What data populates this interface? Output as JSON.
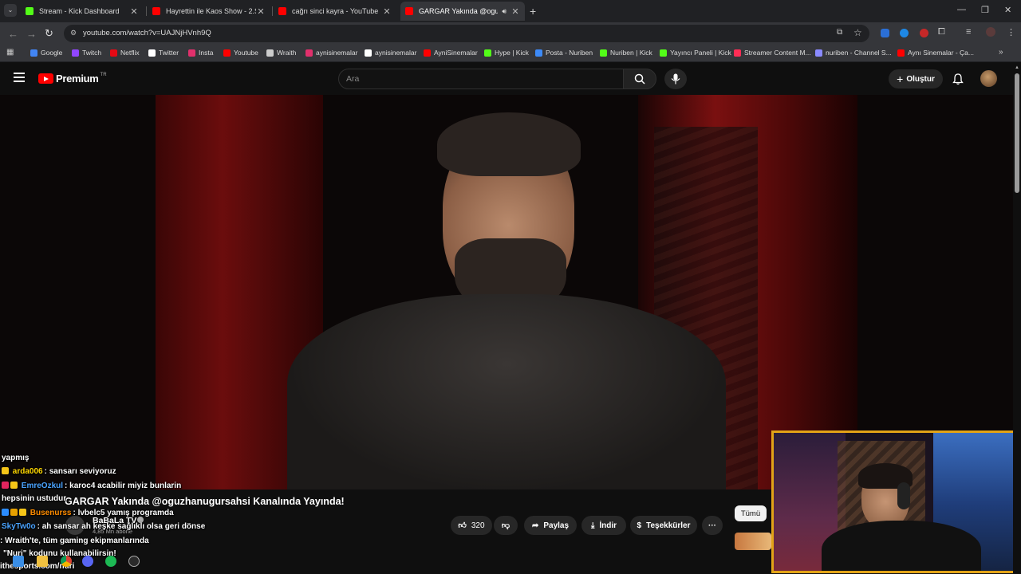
{
  "browser": {
    "tabs": [
      {
        "title": "Stream - Kick Dashboard",
        "icon": "kick-icon",
        "color": "#53fc18"
      },
      {
        "title": "Hayrettin ile Kaos Show - 2.Sez",
        "icon": "youtube-icon",
        "color": "#ff0000"
      },
      {
        "title": "cağrı sinci kayra - YouTube",
        "icon": "youtube-icon",
        "color": "#ff0000"
      },
      {
        "title": "GARGAR Yakında @oguzha",
        "icon": "youtube-icon",
        "color": "#ff0000",
        "active": true
      }
    ],
    "url": "youtube.com/watch?v=UAJNjHVnh9Q",
    "bookmarks": [
      {
        "label": "Google",
        "icon": "google-icon",
        "color": "#4285f4"
      },
      {
        "label": "Twitch",
        "icon": "twitch-icon",
        "color": "#9146ff"
      },
      {
        "label": "Netflix",
        "icon": "netflix-icon",
        "color": "#e50914"
      },
      {
        "label": "Twitter",
        "icon": "x-icon",
        "color": "#ffffff"
      },
      {
        "label": "Insta",
        "icon": "instagram-icon",
        "color": "#e1306c"
      },
      {
        "label": "Youtube",
        "icon": "youtube-icon",
        "color": "#ff0000"
      },
      {
        "label": "Wraith",
        "icon": "wraith-icon",
        "color": "#cccccc"
      },
      {
        "label": "aynisinemalar",
        "icon": "instagram-icon",
        "color": "#e1306c"
      },
      {
        "label": "aynisinemalar",
        "icon": "x-icon",
        "color": "#ffffff"
      },
      {
        "label": "AyniSinemalar",
        "icon": "youtube-icon",
        "color": "#ff0000"
      },
      {
        "label": "Hype | Kick",
        "icon": "kick-icon",
        "color": "#53fc18"
      },
      {
        "label": "Posta - Nuriben",
        "icon": "mail-icon",
        "color": "#3d8af7"
      },
      {
        "label": "Nuriben | Kick",
        "icon": "kick-icon",
        "color": "#53fc18"
      },
      {
        "label": "Yayıncı Paneli | Kick",
        "icon": "kick-icon",
        "color": "#53fc18"
      },
      {
        "label": "Streamer Content M...",
        "icon": "streamer-icon",
        "color": "#ff2d55"
      },
      {
        "label": "nuriben - Channel S...",
        "icon": "channel-icon",
        "color": "#8a8aff"
      },
      {
        "label": "Aynı Sinemalar - Ça...",
        "icon": "youtube-icon",
        "color": "#ff0000"
      }
    ]
  },
  "youtube": {
    "logo": "Premium",
    "logo_region": "TR",
    "search_placeholder": "Ara",
    "create_label": "Oluştur",
    "video_title": "GARGAR Yakında @oguzhanugursahsi Kanalında Yayında!",
    "channel_name": "BaBaLa TV",
    "subscribers": "4,85 Mn abone",
    "likes": "320",
    "share_label": "Paylaş",
    "download_label": "İndir",
    "thanks_label": "Teşekkürler",
    "filter_all": "Tümü"
  },
  "chat": [
    {
      "user": "",
      "text": "yapmış",
      "user_color": "#ffffff"
    },
    {
      "user": "arda006",
      "text": ": sansarı seviyoruz",
      "user_color": "#ffd700"
    },
    {
      "user": "EmreOzkul",
      "text": ": karoc4 acabilir miyiz bunlarin",
      "user_color": "#4aa3ff"
    },
    {
      "user": "",
      "text": "hepsinin ustudur",
      "user_color": "#ffffff"
    },
    {
      "user": "Busenurss",
      "text": ": lvbelc5 yamış programda",
      "user_color": "#ff8c00"
    },
    {
      "user": "SkyTw0o",
      "text": ": ah sansar ah keşke sağlıklı olsa geri dönse",
      "user_color": "#4aa3ff"
    },
    {
      "user": "",
      "text": ": Wraith'te, tüm gaming ekipmanlarında",
      "user_color": "#ffffff"
    },
    {
      "user": "",
      "text": "\"Nuri\" kodunu kullanabilirsin!",
      "user_color": "#ffffff"
    },
    {
      "user": "",
      "text": "ithesports.com/nuri",
      "user_color": "#ffffff"
    }
  ],
  "colors": {
    "accent_red": "#ff0000",
    "webcam_border": "#e2a317",
    "kick_green": "#53fc18"
  }
}
